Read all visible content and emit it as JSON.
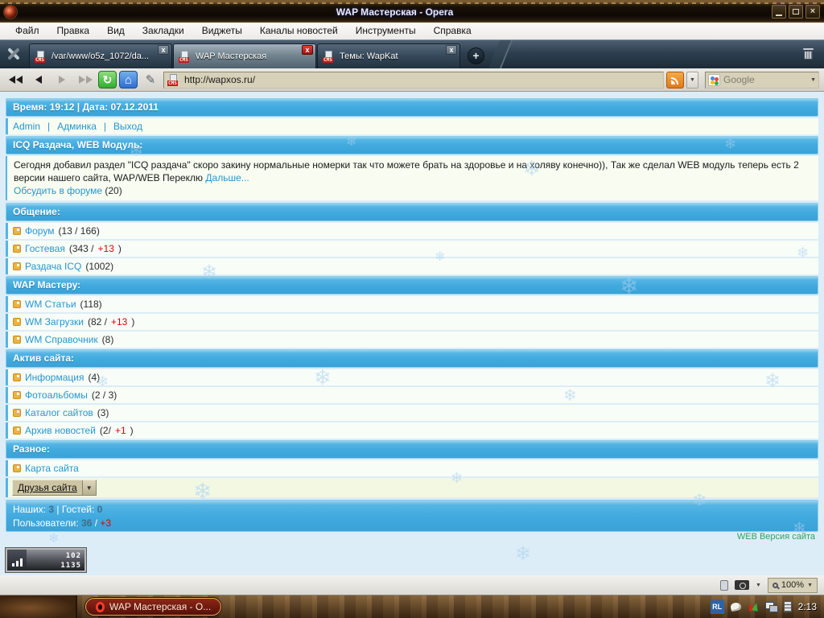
{
  "window": {
    "title": "WAP Мастерская - Opera",
    "menu": [
      "Файл",
      "Правка",
      "Вид",
      "Закладки",
      "Виджеты",
      "Каналы новостей",
      "Инструменты",
      "Справка"
    ],
    "tabs": [
      {
        "label": "/var/www/o5z_1072/da...",
        "active": false
      },
      {
        "label": "WAP Мастерская",
        "active": true
      },
      {
        "label": "Темы: WapKat",
        "active": false
      }
    ],
    "cms_badge": "CMS",
    "address": "http://wapxos.ru/",
    "search_placeholder": "Google",
    "zoom_level": "100%"
  },
  "icons": {
    "dropdown": "▼",
    "plus": "+",
    "close": "×",
    "tab_close": "x",
    "reload": "↻",
    "home": "⌂",
    "pencil": "✎",
    "snowflake": "❄"
  },
  "page": {
    "datetime_bar": "Время: 19:12 | Дата: 07.12.2011",
    "admin": {
      "links": [
        "Admin",
        "Админка",
        "Выход"
      ],
      "separator": "|"
    },
    "news": {
      "header": "ICQ Раздача, WEB Модуль:",
      "text": "Сегодня добавил раздел \"ICQ раздача\" скоро закину нормальные номерки так что можете брать на здоровье и на холяву конечно)), Так же сделал WEB модуль теперь есть 2 версии нашего сайта, WAP/WEB Переклю",
      "more_link": "Дальше...",
      "discuss_link": "Обсудить в форуме",
      "discuss_count": "(20)"
    },
    "sections": [
      {
        "header": "Общение:",
        "items": [
          {
            "label": "Форум",
            "count": "(13 / 166)"
          },
          {
            "label": "Гостевая",
            "count": "(343 / ",
            "count_red": "+13",
            "count_after": ")"
          },
          {
            "label": "Раздача ICQ",
            "count": "(1002)"
          }
        ]
      },
      {
        "header": "WAP Мастеру:",
        "items": [
          {
            "label": "WM Статьи",
            "count": "(118)"
          },
          {
            "label": "WM Загрузки",
            "count": "(82 / ",
            "count_red": "+13",
            "count_after": ")"
          },
          {
            "label": "WM Справочник",
            "count": "(8)"
          }
        ]
      },
      {
        "header": "Актив сайта:",
        "items": [
          {
            "label": "Информация",
            "count": "(4)"
          },
          {
            "label": "Фотоальбомы",
            "count": "(2 / 3)"
          },
          {
            "label": "Каталог сайтов",
            "count": "(3)"
          },
          {
            "label": "Архив новостей",
            "count": "(2/",
            "count_red": "+1",
            "count_after": ")"
          }
        ]
      },
      {
        "header": "Разное:",
        "items": [
          {
            "label": "Карта сайта",
            "count": ""
          }
        ]
      }
    ],
    "friends_select": "Друзья сайта",
    "stats": {
      "ours_label": "Наших:",
      "ours": "3",
      "sep1": "|",
      "guests_label": "Гостей:",
      "guests": "0",
      "users_label": "Пользователи:",
      "users": "36",
      "sep2": "/",
      "users_new": "+3"
    },
    "web_version_link": "WEB Версия сайта",
    "counter": {
      "line1": "102",
      "line2": "1135"
    }
  },
  "statusbar": {
    "zoom_level": "100%"
  },
  "taskbar": {
    "task_button": "WAP Мастерская - O...",
    "lang_indicator": "RL",
    "clock": "2:13"
  },
  "colors": {
    "accent_blue": "#45aede",
    "link_blue": "#2596cf",
    "alert_red": "#e10000",
    "green_link": "#2fa35f",
    "field_tan": "#d6d1b8"
  }
}
